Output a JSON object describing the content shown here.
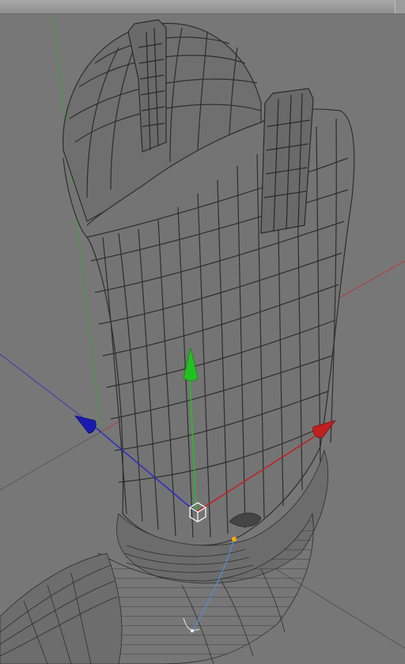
{
  "viewport": {
    "scene": "boot-wireframe-model",
    "background_color": "#777777",
    "mesh_color": "#2e2e2e",
    "gizmo": {
      "x_axis_color": "#c02020",
      "y_axis_color": "#22c022",
      "z_axis_color": "#1a1ab0",
      "pivot_color": "#ffffff"
    },
    "world_axis_colors": {
      "x": "#b83a3a",
      "y": "#3aa03a",
      "z": "#3a3ab8"
    },
    "bone_color": "#4f8fd8",
    "joint_color": "#ffaa00"
  }
}
